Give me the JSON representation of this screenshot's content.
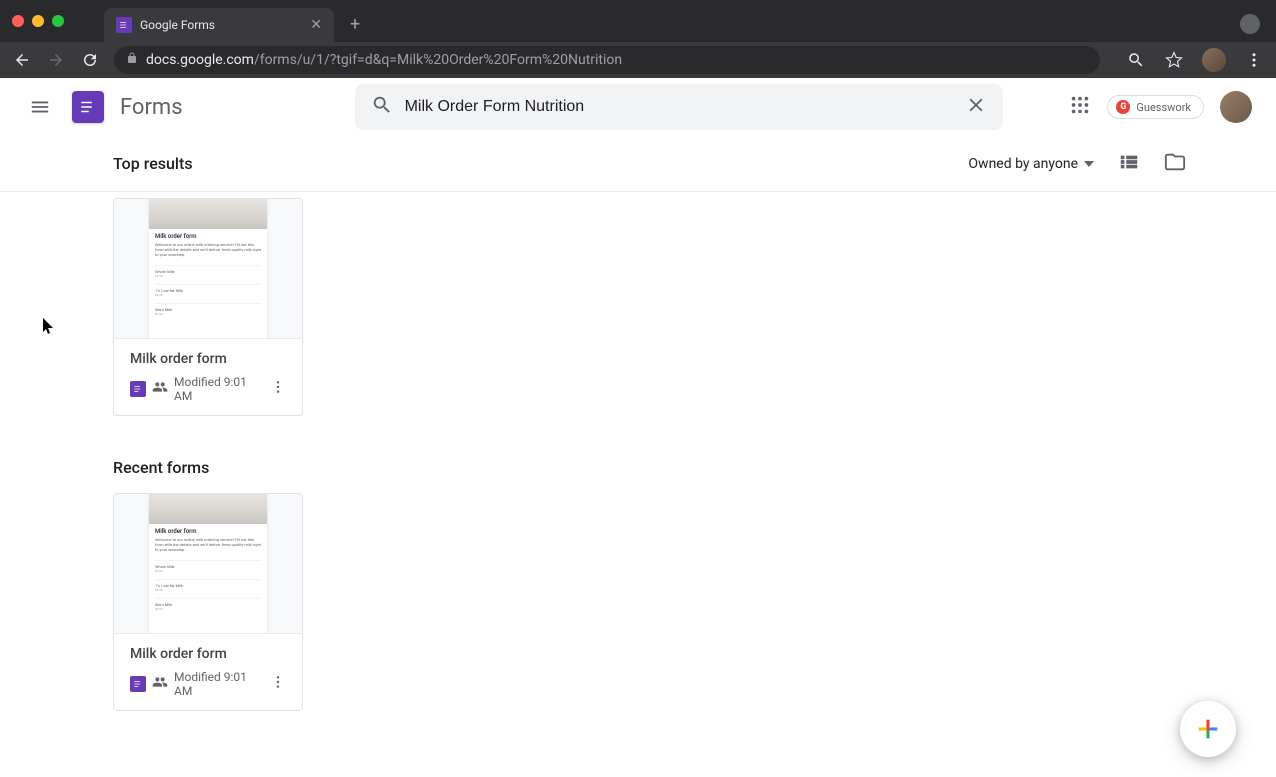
{
  "browser": {
    "tab_title": "Google Forms",
    "url_host": "docs.google.com",
    "url_path": "/forms/u/1/?tgif=d&q=Milk%20Order%20Form%20Nutrition"
  },
  "app": {
    "title": "Forms",
    "search_value": "Milk Order Form Nutrition",
    "guesswork_label": "Guesswork"
  },
  "controls": {
    "top_results_label": "Top results",
    "owned_by_label": "Owned by anyone",
    "recent_forms_label": "Recent forms"
  },
  "cards": {
    "top": {
      "title": "Milk order form",
      "modified": "Modified 9:01 AM",
      "thumb_title": "Milk order form",
      "thumb_desc": "Welcome to our online milk ordering service! Fill out this form with the details and we'll deliver fresh quality milk right to your doorstep."
    },
    "recent": {
      "title": "Milk order form",
      "modified": "Modified 9:01 AM",
      "thumb_title": "Milk order form",
      "thumb_desc": "Welcome to our online milk ordering service! Fill out this form with the details and we'll deliver fresh quality milk right to your doorstep."
    }
  }
}
